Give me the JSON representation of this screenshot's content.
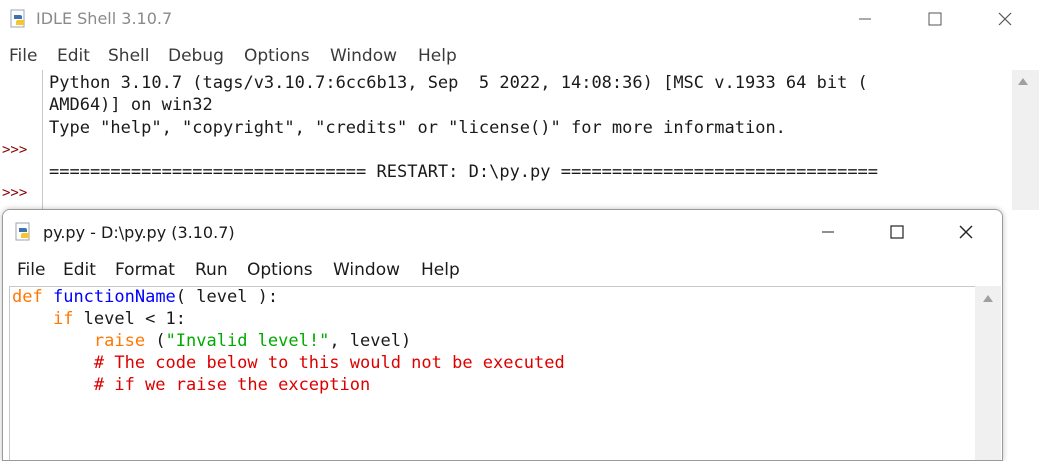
{
  "shell": {
    "title": "IDLE Shell 3.10.7",
    "menu": [
      "File",
      "Edit",
      "Shell",
      "Debug",
      "Options",
      "Window",
      "Help"
    ],
    "prompts": [
      ">>>",
      ">>>"
    ],
    "lines": [
      "Python 3.10.7 (tags/v3.10.7:6cc6b13, Sep  5 2022, 14:08:36) [MSC v.1933 64 bit (",
      "AMD64)] on win32",
      "Type \"help\", \"copyright\", \"credits\" or \"license()\" for more information.",
      "=============================== RESTART: D:\\py.py ==============================="
    ]
  },
  "editor": {
    "title": "py.py - D:\\py.py (3.10.7)",
    "menu": [
      "File",
      "Edit",
      "Format",
      "Run",
      "Options",
      "Window",
      "Help"
    ],
    "code": {
      "l1_kw": "def",
      "l1_fn": "functionName",
      "l1_rest": "( level ):",
      "l2_indent": "    ",
      "l2_kw": "if",
      "l2_rest": " level < 1:",
      "l3_indent": "        ",
      "l3_kw": "raise",
      "l3_mid": " (",
      "l3_str": "\"Invalid level!\"",
      "l3_rest": ", level)",
      "l4": "        # The code below to this would not be executed",
      "l5": "        # if we raise the exception"
    }
  },
  "colors": {
    "keyword": "#ff7700",
    "function_name": "#0000ff",
    "string": "#00aa00",
    "comment": "#dd0000",
    "prompt": "#8b0000"
  }
}
